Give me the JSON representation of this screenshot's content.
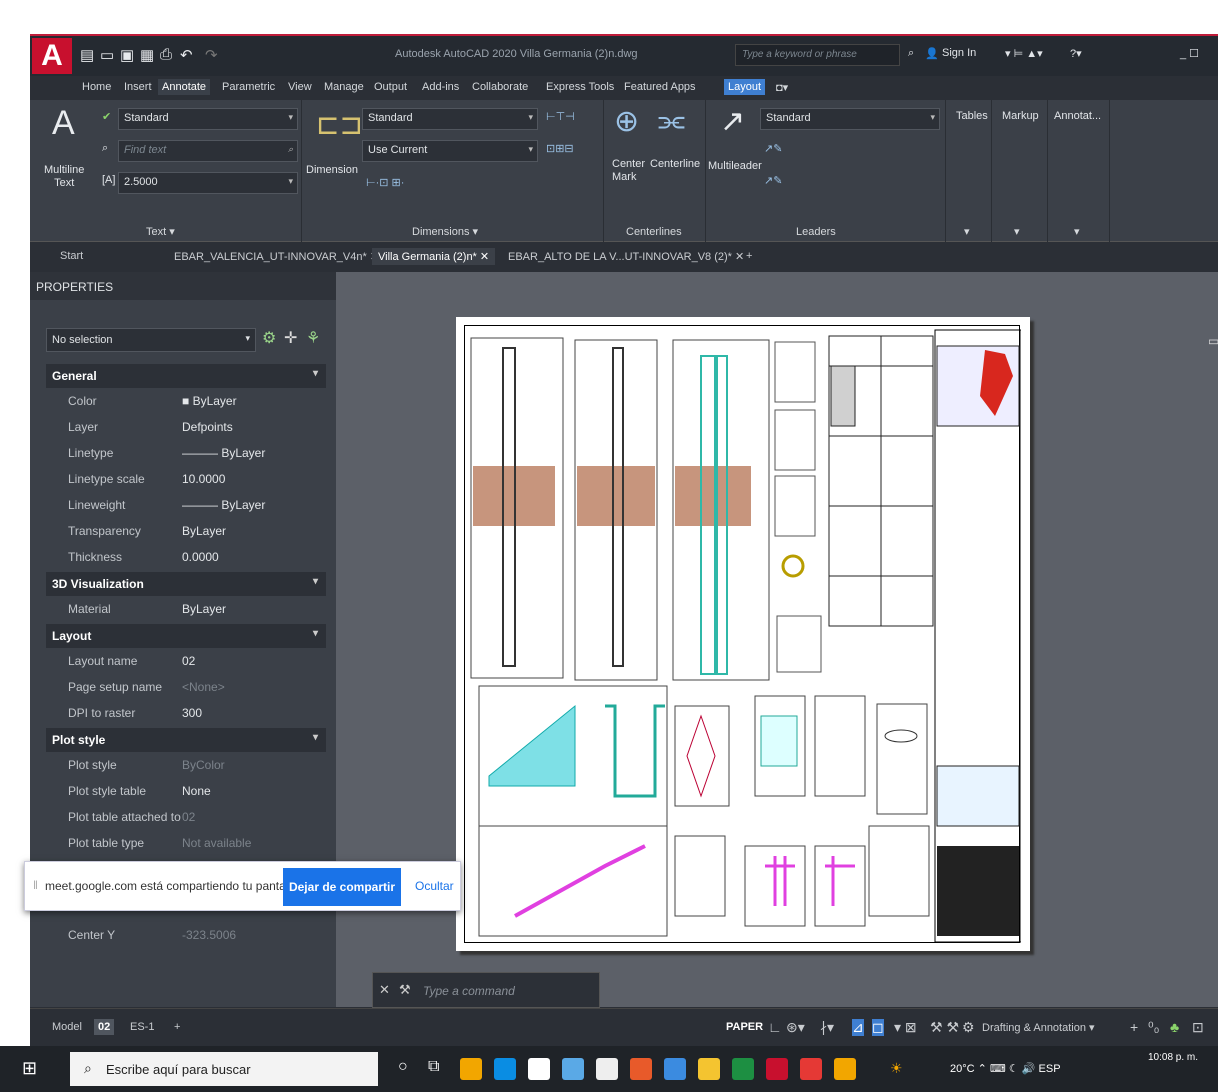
{
  "window": {
    "title": "Autodesk AutoCAD 2020   Villa Germania (2)n.dwg",
    "search_placeholder": "Type a keyword or phrase",
    "sign_in": "Sign In",
    "logo": "A"
  },
  "menu": {
    "tabs": [
      "Home",
      "Insert",
      "Annotate",
      "Parametric",
      "View",
      "Manage",
      "Output",
      "Add-ins",
      "Collaborate",
      "Express Tools",
      "Featured Apps",
      "Layout"
    ],
    "active": "Annotate"
  },
  "ribbon": {
    "text": {
      "big_label": "Multiline\nText",
      "style": "Standard",
      "find_placeholder": "Find text",
      "height": "2.5000",
      "panel": "Text ▾"
    },
    "dimensions": {
      "big_label": "Dimension",
      "style": "Standard",
      "layer": "Use Current",
      "panel": "Dimensions ▾"
    },
    "centerlines": {
      "center_mark": "Center\nMark",
      "centerline": "Centerline",
      "panel": "Centerlines"
    },
    "leaders": {
      "big_label": "Multileader",
      "style": "Standard",
      "panel": "Leaders"
    },
    "tables": "Tables",
    "markup": "Markup",
    "annotat": "Annotat..."
  },
  "doc_tabs": [
    "Start",
    "EBAR_VALENCIA_UT-INNOVAR_V4n*",
    "Villa Germania (2)n*",
    "EBAR_ALTO DE LA V...UT-INNOVAR_V8 (2)*"
  ],
  "properties": {
    "header": "PROPERTIES",
    "selection": "No selection",
    "sections": [
      {
        "name": "General",
        "rows": [
          [
            "Color",
            "■ ByLayer"
          ],
          [
            "Layer",
            "Defpoints"
          ],
          [
            "Linetype",
            "——— ByLayer"
          ],
          [
            "Linetype scale",
            "10.0000"
          ],
          [
            "Lineweight",
            "——— ByLayer"
          ],
          [
            "Transparency",
            "ByLayer"
          ],
          [
            "Thickness",
            "0.0000"
          ]
        ]
      },
      {
        "name": "3D Visualization",
        "rows": [
          [
            "Material",
            "ByLayer"
          ]
        ]
      },
      {
        "name": "Layout",
        "rows": [
          [
            "Layout name",
            "02"
          ],
          [
            "Page setup name",
            "<None>"
          ],
          [
            "DPI to raster",
            "300"
          ]
        ]
      },
      {
        "name": "Plot style",
        "rows": [
          [
            "Plot style",
            "ByColor"
          ],
          [
            "Plot style table",
            "None"
          ],
          [
            "Plot table attached to",
            "02"
          ],
          [
            "Plot table type",
            "Not available"
          ]
        ]
      }
    ],
    "center_y_label": "Center Y",
    "center_y_value": "-323.5006"
  },
  "share_bar": {
    "text": "meet.google.com está compartiendo tu pantalla.",
    "stop": "Dejar de compartir",
    "hide": "Ocultar"
  },
  "command": {
    "placeholder": "Type a command"
  },
  "status": {
    "tabs": [
      "Model",
      "02",
      "ES-1"
    ],
    "paper": "PAPER",
    "workspace": "Drafting & Annotation ▾"
  },
  "taskbar": {
    "search": "Escribe aquí para buscar",
    "temp": "20°C",
    "lang": "ESP",
    "time": "10:08 p. m."
  },
  "colors": {
    "accent": "#3f7fd1",
    "brand": "#c8102e",
    "share_button": "#1a73e8"
  }
}
